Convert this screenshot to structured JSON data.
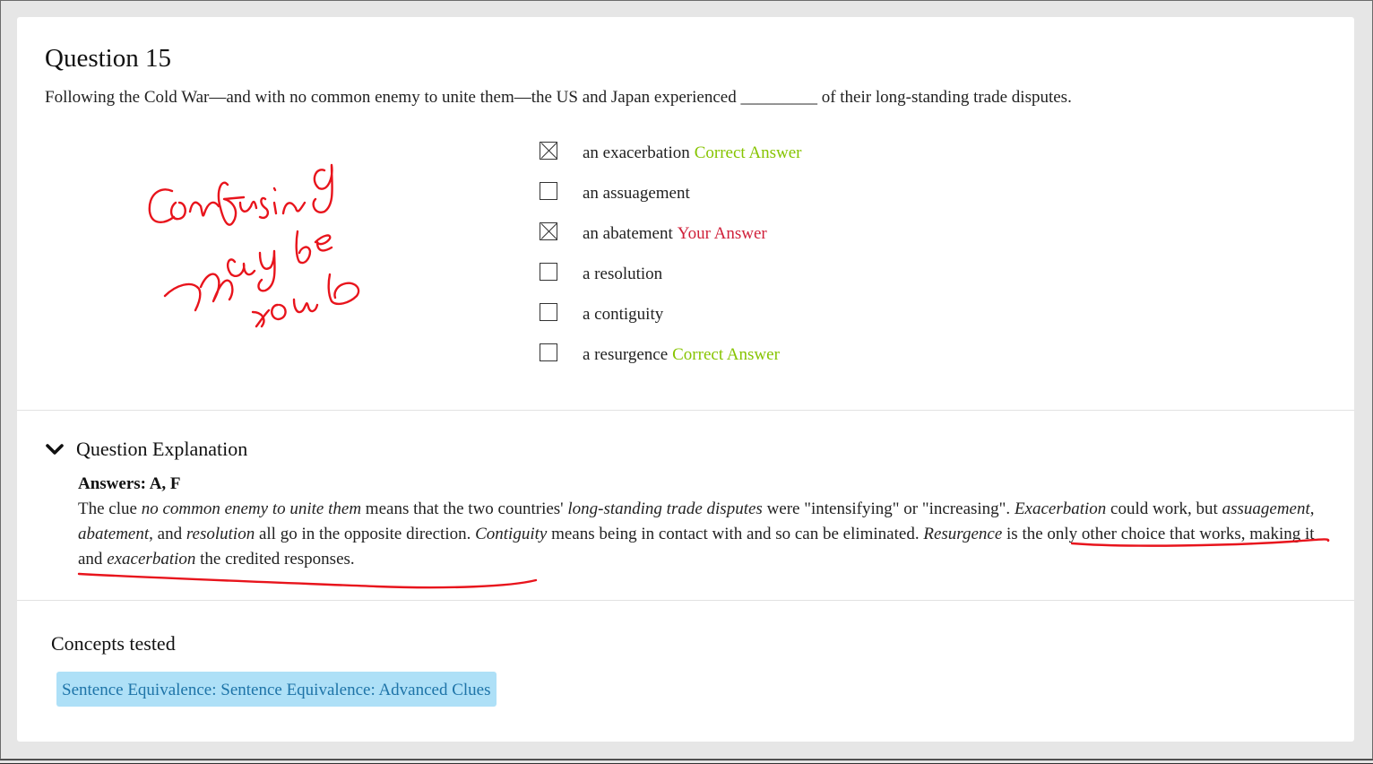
{
  "question": {
    "title": "Question 15",
    "stem": "Following the Cold War—and with no common enemy to unite them—the US and Japan experienced _________ of their long-standing trade disputes."
  },
  "options": [
    {
      "text": "an exacerbation",
      "checked": true,
      "tag": "Correct Answer",
      "tag_type": "correct"
    },
    {
      "text": "an assuagement",
      "checked": false,
      "tag": "",
      "tag_type": ""
    },
    {
      "text": "an abatement",
      "checked": true,
      "tag": "Your Answer",
      "tag_type": "yours"
    },
    {
      "text": "a resolution",
      "checked": false,
      "tag": "",
      "tag_type": ""
    },
    {
      "text": "a contiguity",
      "checked": false,
      "tag": "",
      "tag_type": ""
    },
    {
      "text": "a resurgence",
      "checked": false,
      "tag": "Correct Answer",
      "tag_type": "correct"
    }
  ],
  "explanation": {
    "title": "Question Explanation",
    "answers": "Answers: A, F",
    "body": {
      "p1": "The clue ",
      "i1": "no common enemy to unite them",
      "p2": " means that the two countries' ",
      "i2": "long-standing trade disputes",
      "p3": " were \"intensifying\" or \"increasing\". ",
      "i3": "Exacerbation",
      "p4": " could work, but ",
      "i4": "assuagement",
      "p5": ", ",
      "i5": "abatement",
      "p6": ", and ",
      "i6": "resolution",
      "p7": " all go in the opposite direction. ",
      "i7": "Contiguity",
      "p8": " means being in contact with and so can be eliminated. ",
      "i8": "Resurgence",
      "p9": " is the only other choice that works, making it and ",
      "i9": "exacerbation",
      "p10": " the credited responses."
    }
  },
  "concepts": {
    "title": "Concepts tested",
    "tag": "Sentence Equivalence: Sentence Equivalence: Advanced Clues"
  },
  "colors": {
    "correct": "#86c400",
    "your_answer": "#d0203a",
    "ink": "#e8141c",
    "concept_bg": "#aee0f7",
    "concept_text": "#1e74a8"
  }
}
